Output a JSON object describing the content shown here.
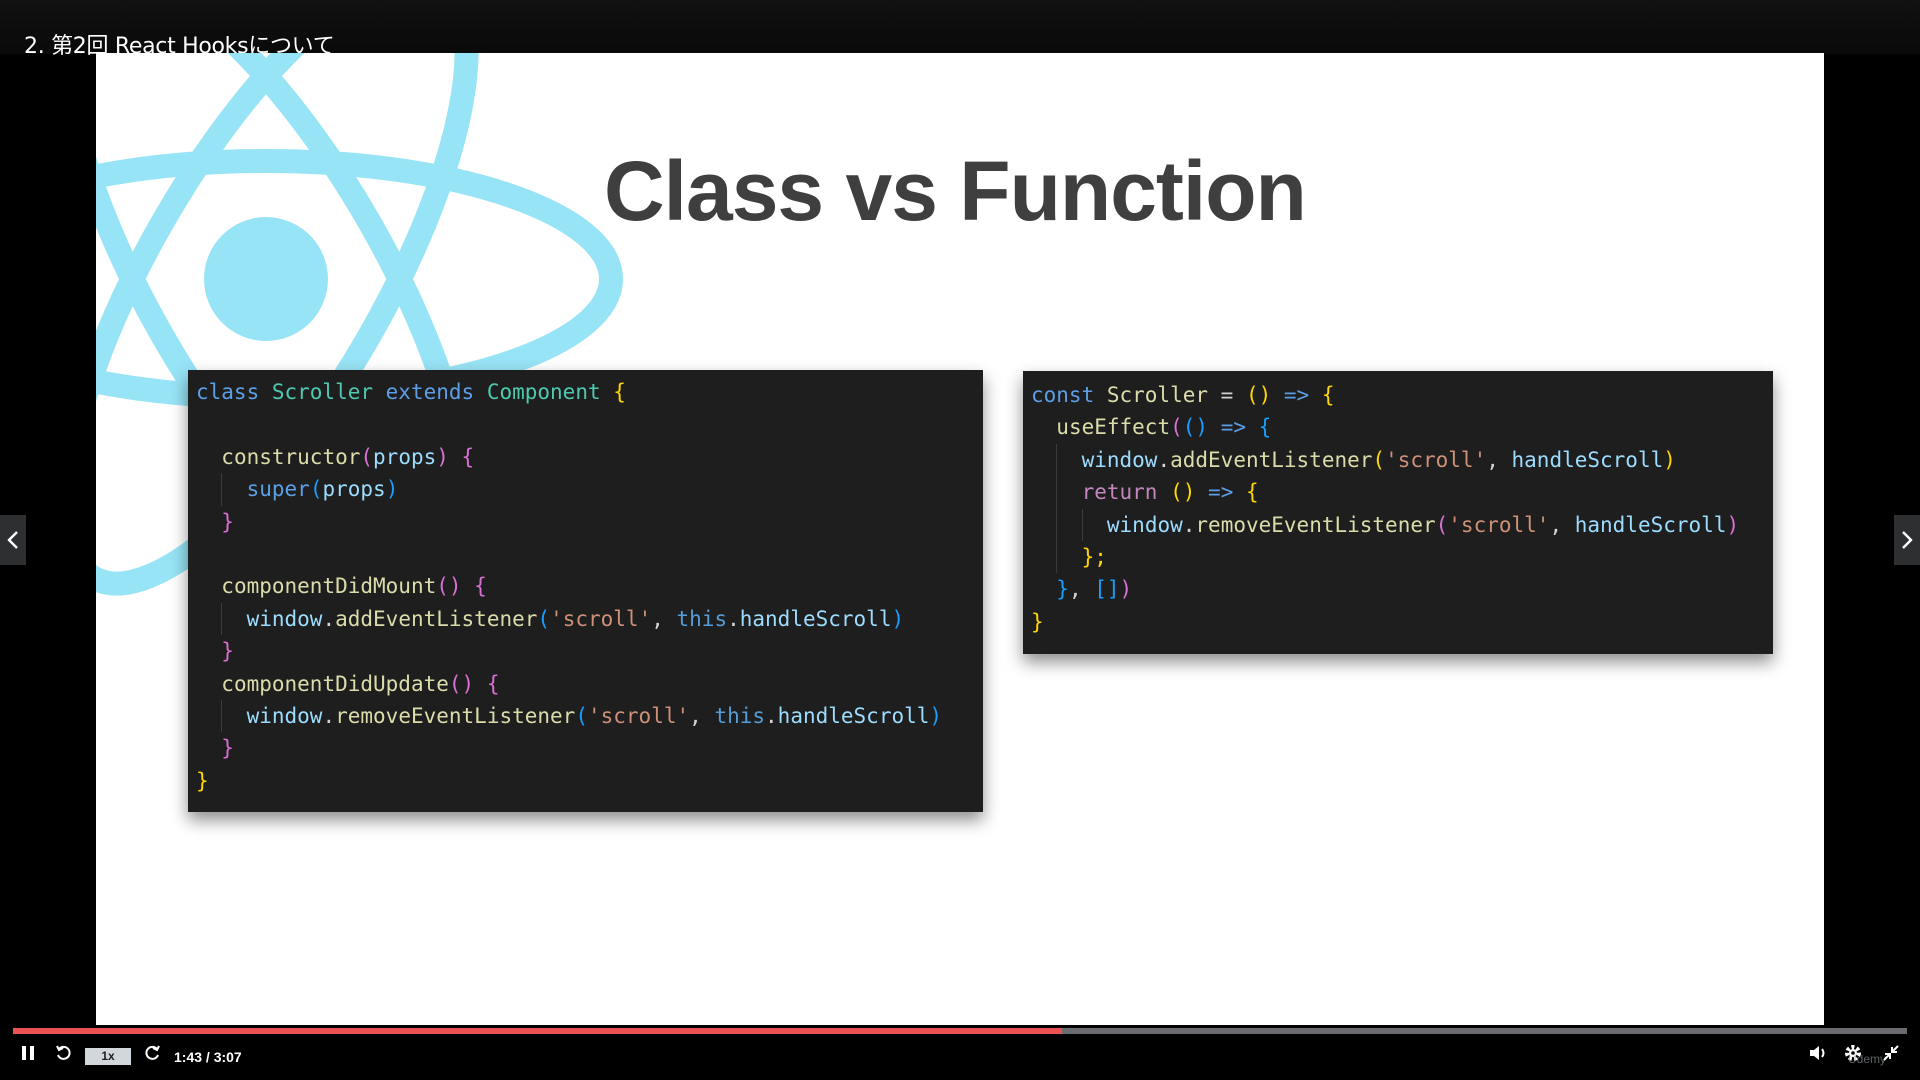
{
  "lecture": {
    "title": "2. 第2回 React Hooksについて"
  },
  "slide": {
    "title": "Class vs Function",
    "class_code": [
      [
        [
          "class ",
          "t-keyword"
        ],
        [
          "Scroller ",
          "t-class"
        ],
        [
          "extends ",
          "t-keyword"
        ],
        [
          "Component ",
          "t-class"
        ],
        [
          "{",
          "b1"
        ]
      ],
      [],
      [
        [
          "constructor",
          "t-func"
        ],
        [
          "(",
          "b2"
        ],
        [
          "props",
          "t-var"
        ],
        [
          ") ",
          "b2"
        ],
        [
          "{",
          "b2"
        ]
      ],
      [
        [
          "super",
          "t-keyword"
        ],
        [
          "(",
          "b3"
        ],
        [
          "props",
          "t-var"
        ],
        [
          ")",
          "b3"
        ]
      ],
      [
        [
          "}",
          "b2"
        ]
      ],
      [],
      [
        [
          "componentDidMount",
          "t-func"
        ],
        [
          "() ",
          "b2"
        ],
        [
          "{",
          "b2"
        ]
      ],
      [
        [
          "window",
          "t-var"
        ],
        [
          ".",
          "t-punct"
        ],
        [
          "addEventListener",
          "t-func"
        ],
        [
          "(",
          "b3"
        ],
        [
          "'scroll'",
          "t-string"
        ],
        [
          ", ",
          "t-punct"
        ],
        [
          "this",
          "t-this"
        ],
        [
          ".",
          "t-punct"
        ],
        [
          "handleScroll",
          "t-var"
        ],
        [
          ")",
          "b3"
        ]
      ],
      [
        [
          "}",
          "b2"
        ]
      ],
      [
        [
          "componentDidUpdate",
          "t-func"
        ],
        [
          "() ",
          "b2"
        ],
        [
          "{",
          "b2"
        ]
      ],
      [
        [
          "window",
          "t-var"
        ],
        [
          ".",
          "t-punct"
        ],
        [
          "removeEventListener",
          "t-func"
        ],
        [
          "(",
          "b3"
        ],
        [
          "'scroll'",
          "t-string"
        ],
        [
          ", ",
          "t-punct"
        ],
        [
          "this",
          "t-this"
        ],
        [
          ".",
          "t-punct"
        ],
        [
          "handleScroll",
          "t-var"
        ],
        [
          ")",
          "b3"
        ]
      ],
      [
        [
          "}",
          "b2"
        ]
      ],
      [
        [
          "}",
          "b1"
        ]
      ]
    ],
    "class_indent": [
      0,
      1,
      1,
      2,
      1,
      1,
      1,
      2,
      1,
      1,
      2,
      1,
      0
    ],
    "function_code": [
      [
        [
          "const ",
          "t-keyword"
        ],
        [
          "Scroller ",
          "t-func"
        ],
        [
          "= ",
          "t-punct"
        ],
        [
          "() ",
          "b1"
        ],
        [
          "=> ",
          "t-keyword"
        ],
        [
          "{",
          "b1"
        ]
      ],
      [
        [
          "useEffect",
          "t-func"
        ],
        [
          "(",
          "b2"
        ],
        [
          "() ",
          "b3"
        ],
        [
          "=> ",
          "t-keyword"
        ],
        [
          "{",
          "b3"
        ]
      ],
      [
        [
          "window",
          "t-var"
        ],
        [
          ".",
          "t-punct"
        ],
        [
          "addEventListener",
          "t-func"
        ],
        [
          "(",
          "b1"
        ],
        [
          "'scroll'",
          "t-string"
        ],
        [
          ", ",
          "t-punct"
        ],
        [
          "handleScroll",
          "t-var"
        ],
        [
          ")",
          "b1"
        ]
      ],
      [
        [
          "return ",
          "t-ret"
        ],
        [
          "() ",
          "b1"
        ],
        [
          "=> ",
          "t-keyword"
        ],
        [
          "{",
          "b1"
        ]
      ],
      [
        [
          "window",
          "t-var"
        ],
        [
          ".",
          "t-punct"
        ],
        [
          "removeEventListener",
          "t-func"
        ],
        [
          "(",
          "b2"
        ],
        [
          "'scroll'",
          "t-string"
        ],
        [
          ", ",
          "t-punct"
        ],
        [
          "handleScroll",
          "t-var"
        ],
        [
          ")",
          "b2"
        ]
      ],
      [
        [
          "};",
          "b1"
        ]
      ],
      [
        [
          "}",
          "b3"
        ],
        [
          ", ",
          "t-punct"
        ],
        [
          "[]",
          "b3"
        ],
        [
          ")",
          "b2"
        ]
      ],
      [
        [
          "}",
          "b1"
        ]
      ]
    ],
    "function_indent": [
      0,
      1,
      2,
      2,
      3,
      2,
      1,
      0
    ]
  },
  "player": {
    "speed_label": "1x",
    "time_display": "1:43 / 3:07",
    "progress_fraction": 0.554,
    "watermark": "Udemy",
    "colors": {
      "progress": "#ec5252",
      "track": "#6a6c6f",
      "react": "#61dafb"
    },
    "icons": [
      "pause-icon",
      "rewind-icon",
      "forward-icon",
      "volume-icon",
      "gear-icon",
      "exit-fullscreen-icon",
      "chevron-left-icon",
      "chevron-right-icon"
    ]
  }
}
